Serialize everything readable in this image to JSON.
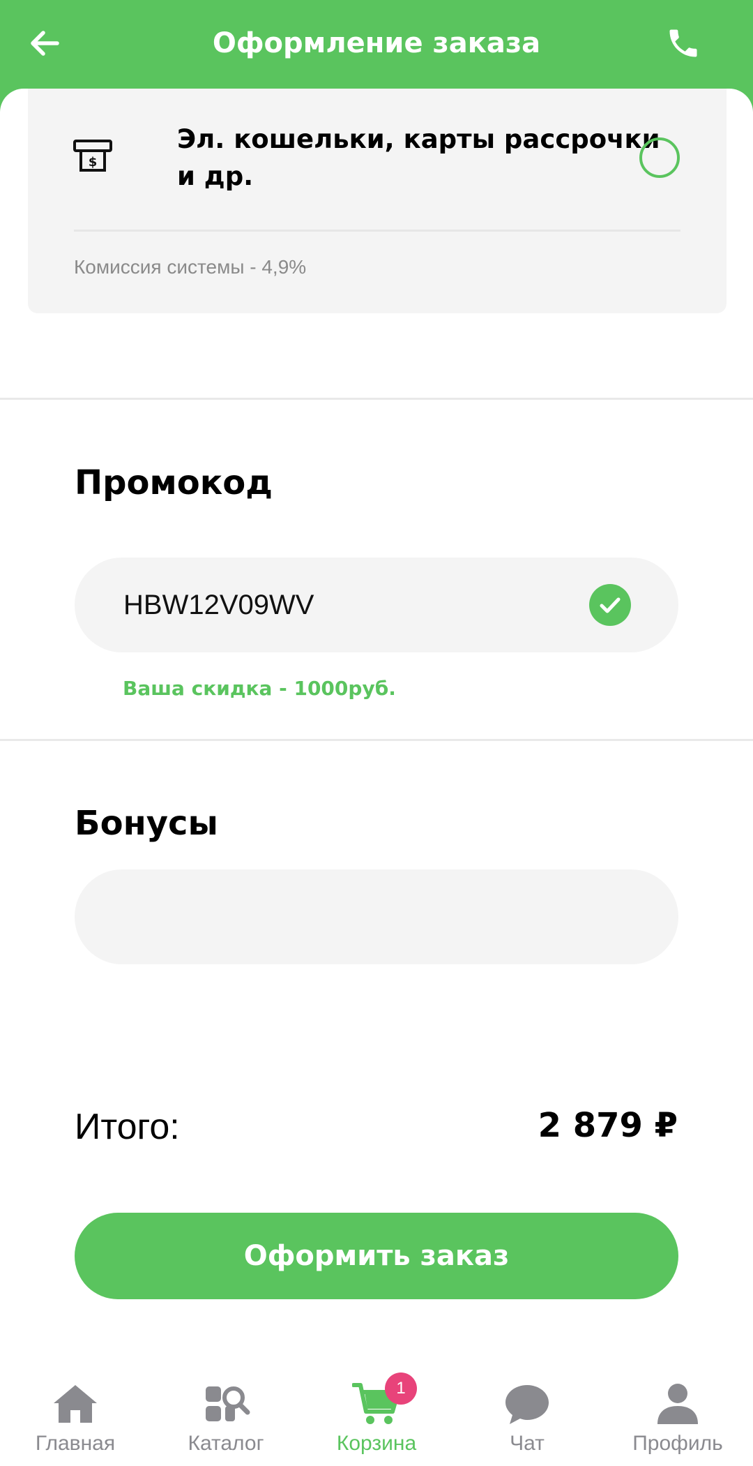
{
  "header": {
    "title": "Оформление заказа"
  },
  "payment_option": {
    "label": "Эл. кошельки, карты рассрочки и др.",
    "fee": "Комиссия системы - 4,9%",
    "selected": false
  },
  "promo": {
    "title": "Промокод",
    "value": "HBW12V09WV",
    "discount_text": "Ваша скидка - 1000руб."
  },
  "bonuses": {
    "title": "Бонусы",
    "value": ""
  },
  "total": {
    "label": "Итого:",
    "value": "2 879 ₽"
  },
  "order_button": {
    "label": "Оформить заказ"
  },
  "tabbar": {
    "items": [
      {
        "label": "Главная",
        "icon": "home-icon"
      },
      {
        "label": "Каталог",
        "icon": "catalog-search-icon"
      },
      {
        "label": "Корзина",
        "icon": "cart-icon",
        "badge": "1"
      },
      {
        "label": "Чат",
        "icon": "chat-bubble-icon"
      },
      {
        "label": "Профиль",
        "icon": "user-icon"
      }
    ],
    "active_index": 2
  },
  "colors": {
    "accent": "#5ac45e",
    "badge": "#e8437a",
    "inactive": "#8a8a8f"
  }
}
